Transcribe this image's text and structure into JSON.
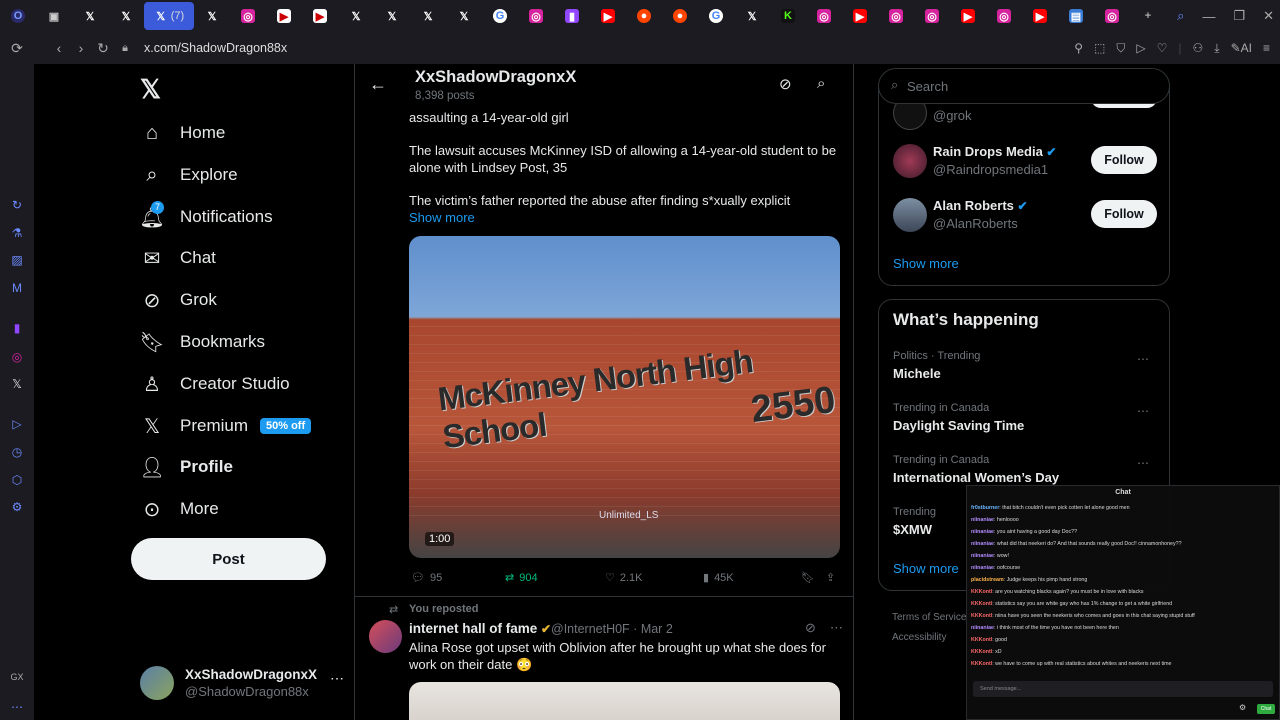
{
  "browser": {
    "tab_count_label": "(7)",
    "url": "x.com/ShadowDragon88x",
    "ai_label": "AI"
  },
  "nav": {
    "items": [
      {
        "label": "Home",
        "icon": "home-icon"
      },
      {
        "label": "Explore",
        "icon": "search-icon"
      },
      {
        "label": "Notifications",
        "icon": "bell-icon",
        "badge": "7"
      },
      {
        "label": "Chat",
        "icon": "mail-icon"
      },
      {
        "label": "Grok",
        "icon": "grok-icon"
      },
      {
        "label": "Bookmarks",
        "icon": "bookmark-icon"
      },
      {
        "label": "Creator Studio",
        "icon": "creator-icon"
      },
      {
        "label": "Premium",
        "icon": "x-icon",
        "promo": "50% off"
      },
      {
        "label": "Profile",
        "icon": "person-icon"
      },
      {
        "label": "More",
        "icon": "more-circle-icon"
      }
    ],
    "post_label": "Post"
  },
  "account": {
    "name": "XxShadowDragonxX",
    "handle": "@ShadowDragon88x"
  },
  "profile_header": {
    "title": "XxShadowDragonxX",
    "subtitle": "8,398 posts"
  },
  "tweet1": {
    "line1": "assaulting a 14-year-old girl",
    "para2": "The lawsuit accuses McKinney ISD of allowing a 14-year-old student to be alone with Lindsey Post, 35",
    "para3": "The victim’s father reported the abuse after finding s*xually explicit",
    "show_more": "Show more",
    "media_sign": "McKinney North High School",
    "media_number": "2550",
    "media_watermark": "Unlimited_LS",
    "video_time": "1:00",
    "replies": "95",
    "reposts": "904",
    "likes": "2.1K",
    "views": "45K"
  },
  "tweet2": {
    "reposted_label": "You reposted",
    "name": "internet hall of fame",
    "handle": "@InternetH0F",
    "date": "Mar 2",
    "text": "Alina Rose got upset with Oblivion after he brought up what she does for work on their date 😳"
  },
  "right": {
    "search_placeholder": "Search",
    "who_to_follow": [
      {
        "handle": "@grok",
        "follow": "Follow"
      },
      {
        "name": "Rain Drops Media",
        "handle": "@Raindropsmedia1",
        "follow": "Follow"
      },
      {
        "name": "Alan Roberts",
        "handle": "@AlanRoberts",
        "follow": "Follow"
      }
    ],
    "show_more": "Show more",
    "happening_title": "What’s happening",
    "trends": [
      {
        "context": "Politics · Trending",
        "name": "Michele"
      },
      {
        "context": "Trending in Canada",
        "name": "Daylight Saving Time"
      },
      {
        "context": "Trending in Canada",
        "name": "International Women’s Day"
      },
      {
        "context": "Trending",
        "name": "$XMW"
      }
    ],
    "show_more_2": "Show more",
    "footer": "Terms of Service",
    "footer2": "Accessibility"
  },
  "chat": {
    "title": "Chat",
    "lines": [
      {
        "user": "fr0stburner",
        "text": ": that bitch couldn't even pick cotten let alone good men"
      },
      {
        "user": "niinaniae",
        "text": ": henloooo"
      },
      {
        "user": "niinaniae",
        "text": ": you aint having a good day Doc??"
      },
      {
        "user": "niinaniae",
        "text": ": what did that neekeri do? And that sounds really good Doc!! cinnamonhoney??"
      },
      {
        "user": "niinaniae",
        "text": ": wow!"
      },
      {
        "user": "niinaniae",
        "text": ": oofcourse"
      },
      {
        "user": "placidstream",
        "text": ": Judge keeps his pimp hand strong"
      },
      {
        "user": "KKKontl",
        "text": ": are you watching blacks again? you must be in love with blacks"
      },
      {
        "user": "KKKontl",
        "text": ": statistics say you are white gay who has 1% change to get a white girlfriend"
      },
      {
        "user": "KKKontl",
        "text": ": niina have you seen the neekeris who comes and goes in this chat saying stupid stuff"
      },
      {
        "user": "niinaniae",
        "text": ": i think most of the time you have not been here then"
      },
      {
        "user": "KKKontl",
        "text": ": good"
      },
      {
        "user": "KKKontl",
        "text": ": xD"
      },
      {
        "user": "KKKontl",
        "text": ": we have to come up with real statistics about whites and neekeris next time"
      }
    ],
    "input_placeholder": "Send message...",
    "send_label": "Chat"
  },
  "colors": {
    "accent": "#1d9bf0",
    "repost_green": "#00ba7c",
    "background": "#000000"
  }
}
